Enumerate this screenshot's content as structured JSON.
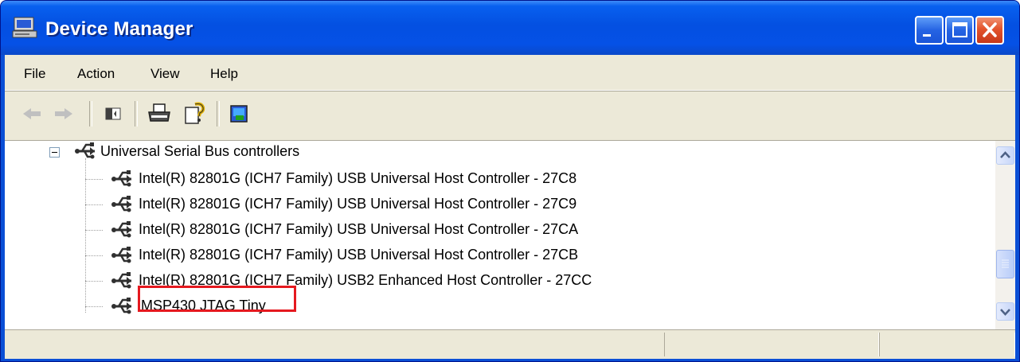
{
  "window": {
    "title": "Device Manager",
    "buttons": {
      "minimize": "minimize",
      "maximize": "maximize",
      "close": "close"
    }
  },
  "menu": {
    "items": [
      "File",
      "Action",
      "View",
      "Help"
    ]
  },
  "toolbar": {
    "icons": [
      "back-arrow-icon",
      "forward-arrow-icon",
      "show-hide-console-tree-icon",
      "print-icon",
      "help-icon",
      "update-driver-icon"
    ]
  },
  "tree": {
    "category": {
      "label": "Universal Serial Bus controllers",
      "expanded": true
    },
    "devices": [
      "Intel(R) 82801G (ICH7 Family) USB Universal Host Controller - 27C8",
      "Intel(R) 82801G (ICH7 Family) USB Universal Host Controller - 27C9",
      "Intel(R) 82801G (ICH7 Family) USB Universal Host Controller - 27CA",
      "Intel(R) 82801G (ICH7 Family) USB Universal Host Controller - 27CB",
      "Intel(R) 82801G (ICH7 Family) USB2 Enhanced Host Controller - 27CC",
      "MSP430 JTAG Tiny"
    ],
    "highlighted_device": "MSP430 JTAG Tiny",
    "highlight_color": "#e5191f"
  },
  "colors": {
    "titlebar": "#0551e6",
    "close_button": "#e3532c",
    "client_background": "#ece9d8"
  }
}
